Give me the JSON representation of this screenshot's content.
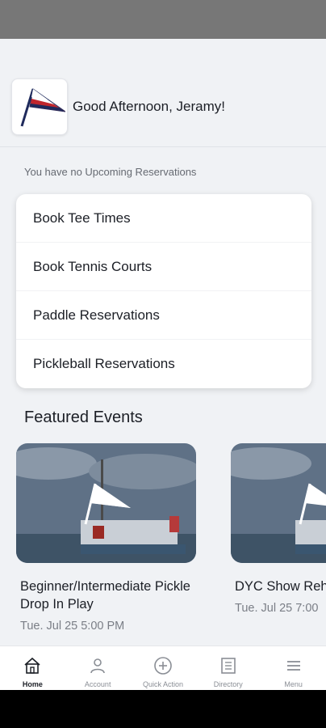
{
  "header": {
    "greeting": "Good Afternoon, Jeramy!"
  },
  "reservations": {
    "empty_message": "You have no Upcoming Reservations"
  },
  "booking_options": [
    {
      "label": "Book Tee Times"
    },
    {
      "label": "Book Tennis Courts"
    },
    {
      "label": "Paddle Reservations"
    },
    {
      "label": "Pickleball Reservations"
    }
  ],
  "featured": {
    "title": "Featured Events",
    "events": [
      {
        "title": "Beginner/Intermediate Pickle Drop In Play",
        "date": "Tue. Jul 25 5:00 PM"
      },
      {
        "title": "DYC Show Reh",
        "date": "Tue. Jul 25 7:00"
      }
    ]
  },
  "bottom_nav": [
    {
      "label": "Home",
      "icon": "home-icon",
      "active": true
    },
    {
      "label": "Account",
      "icon": "account-icon",
      "active": false
    },
    {
      "label": "Quick Action",
      "icon": "plus-circle-icon",
      "active": false
    },
    {
      "label": "Directory",
      "icon": "directory-icon",
      "active": false
    },
    {
      "label": "Menu",
      "icon": "menu-icon",
      "active": false
    }
  ],
  "colors": {
    "background": "#f0f2f5",
    "burgee_red": "#c0262d",
    "burgee_navy": "#1f2a5c"
  }
}
